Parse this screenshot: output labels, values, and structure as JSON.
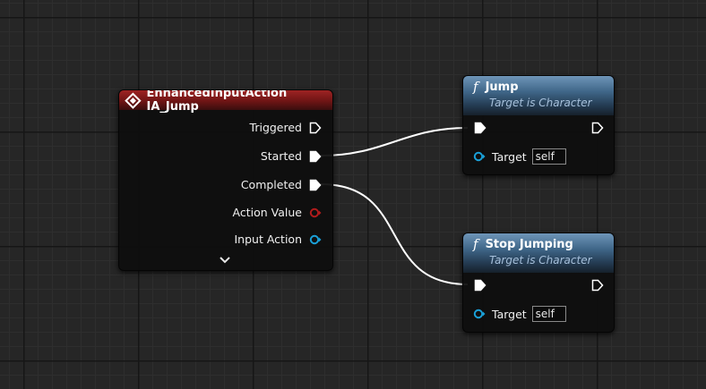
{
  "event_node": {
    "title": "EnhancedInputAction IA_Jump",
    "pins": {
      "triggered": "Triggered",
      "started": "Started",
      "completed": "Completed",
      "action_value": "Action Value",
      "input_action": "Input Action"
    },
    "header_color": "#8a1c1c",
    "icon": "event-diamond-icon"
  },
  "jump_node": {
    "title": "Jump",
    "subtitle": "Target is Character",
    "target_label": "Target",
    "target_value": "self",
    "icon": "function-icon"
  },
  "stop_jumping_node": {
    "title": "Stop Jumping",
    "subtitle": "Target is Character",
    "target_label": "Target",
    "target_value": "self",
    "icon": "function-icon"
  },
  "colors": {
    "canvas": "#262626",
    "function_header": "#3f6688",
    "exec_wire": "#ffffff",
    "object_pin": "#1aa0d8",
    "struct_pin": "#b01c1c"
  }
}
